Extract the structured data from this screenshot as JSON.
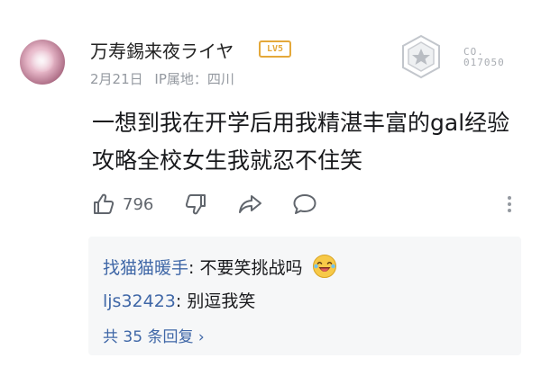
{
  "comment": {
    "username": "万寿錫来夜ライヤ",
    "level": "LV5",
    "date": "2月21日",
    "ip_location": "IP属地：四川",
    "badge_text_line1": "CO.",
    "badge_text_line2": "017050",
    "text": "一想到我在开学后用我精湛丰富的gal经验攻略全校女生我就忍不住笑",
    "like_count": "796"
  },
  "replies": [
    {
      "name": "找猫猫暖手",
      "separator": ": ",
      "text": "不要笑挑战吗"
    },
    {
      "name": "ljs32423",
      "separator": ": ",
      "text": "别逗我笑"
    }
  ],
  "more_replies": "共 35 条回复 ›",
  "icons": [
    "thumbs-up-icon",
    "thumbs-down-icon",
    "share-icon",
    "comment-icon",
    "more-icon",
    "laughing-emoji-icon"
  ],
  "colors": {
    "username": "#222222",
    "reply_name": "#3f67a7",
    "level": "#e4a83a",
    "meta": "#9499a0"
  }
}
